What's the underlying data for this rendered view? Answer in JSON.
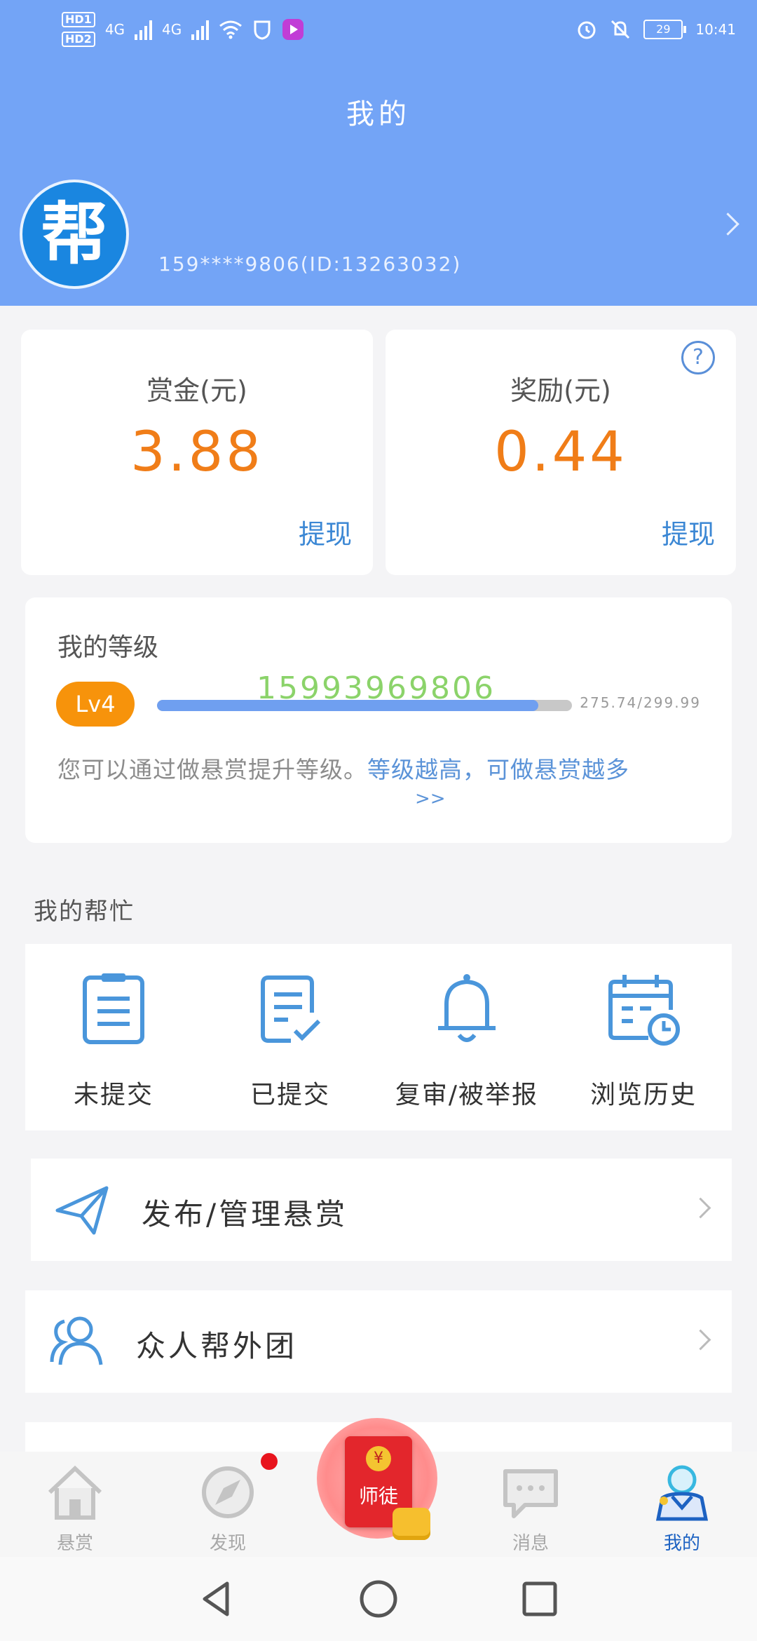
{
  "status_bar": {
    "hd1": "HD1",
    "hd2": "HD2",
    "net1": "4G",
    "net2": "4G",
    "battery": "29",
    "time": "10:41"
  },
  "header": {
    "title": "我的",
    "avatar_text": "帮",
    "user_id": "159****9806(ID:13263032)"
  },
  "wallet": {
    "bounty_title": "赏金(元)",
    "bounty_value": "3.88",
    "bounty_withdraw": "提现",
    "reward_title": "奖励(元)",
    "reward_value": "0.44",
    "reward_withdraw": "提现",
    "help_symbol": "?"
  },
  "level": {
    "title": "我的等级",
    "badge": "Lv4",
    "overlay_number": "15993969806",
    "value_text": "275.74/299.99",
    "progress_fraction": 0.919,
    "desc_gray": "您可以通过做悬赏提升等级。",
    "desc_link": "等级越高，可做悬赏越多",
    "more": ">>"
  },
  "my_help": {
    "title": "我的帮忙",
    "items": [
      {
        "label": "未提交",
        "icon": "clipboard-icon"
      },
      {
        "label": "已提交",
        "icon": "checked-document-icon"
      },
      {
        "label": "复审/被举报",
        "icon": "bell-icon"
      },
      {
        "label": "浏览历史",
        "icon": "calendar-clock-icon"
      }
    ]
  },
  "menu": [
    {
      "label": "发布/管理悬赏",
      "icon": "paper-plane-icon"
    },
    {
      "label": "众人帮外团",
      "icon": "users-icon"
    }
  ],
  "tabbar": {
    "tabs": [
      {
        "label": "悬赏",
        "icon": "home-icon"
      },
      {
        "label": "发现",
        "icon": "compass-icon"
      },
      {
        "label": "消息",
        "icon": "chat-icon"
      },
      {
        "label": "我的",
        "icon": "profile-icon"
      }
    ],
    "center_label": "师徒",
    "coin_symbol": "¥"
  },
  "colors": {
    "header": "#73a4f6",
    "amount": "#f07d18",
    "link": "#3b87d4",
    "level_badge": "#f7930b",
    "active_tab": "#1d62c2"
  }
}
